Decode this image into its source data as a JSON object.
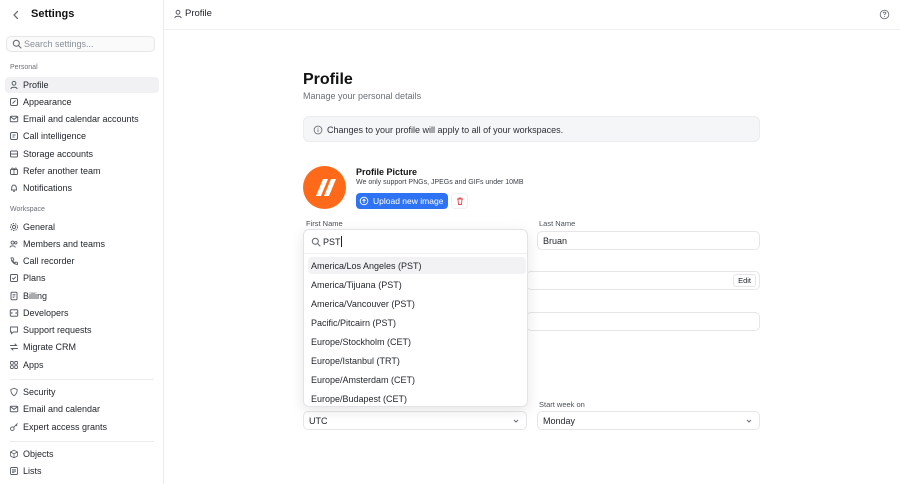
{
  "sidebar": {
    "title": "Settings",
    "search_placeholder": "Search settings...",
    "personal_label": "Personal",
    "personal_items": [
      {
        "label": "Profile",
        "icon": "user-icon"
      },
      {
        "label": "Appearance",
        "icon": "appearance-icon"
      },
      {
        "label": "Email and calendar accounts",
        "icon": "mail-icon"
      },
      {
        "label": "Call intelligence",
        "icon": "call-intelligence-icon"
      },
      {
        "label": "Storage accounts",
        "icon": "storage-icon"
      },
      {
        "label": "Refer another team",
        "icon": "refer-icon"
      },
      {
        "label": "Notifications",
        "icon": "bell-icon"
      }
    ],
    "workspace_label": "Workspace",
    "workspace_items": [
      {
        "label": "General",
        "icon": "gear-icon"
      },
      {
        "label": "Members and teams",
        "icon": "members-icon"
      },
      {
        "label": "Call recorder",
        "icon": "recorder-icon"
      },
      {
        "label": "Plans",
        "icon": "plans-icon"
      },
      {
        "label": "Billing",
        "icon": "billing-icon"
      },
      {
        "label": "Developers",
        "icon": "code-icon"
      },
      {
        "label": "Support requests",
        "icon": "support-icon"
      },
      {
        "label": "Migrate CRM",
        "icon": "migrate-icon"
      },
      {
        "label": "Apps",
        "icon": "apps-icon"
      }
    ],
    "security_items": [
      {
        "label": "Security",
        "icon": "shield-icon"
      },
      {
        "label": "Email and calendar",
        "icon": "mail-icon"
      },
      {
        "label": "Expert access grants",
        "icon": "key-icon"
      }
    ],
    "data_items": [
      {
        "label": "Objects",
        "icon": "objects-icon"
      },
      {
        "label": "Lists",
        "icon": "lists-icon"
      }
    ]
  },
  "header": {
    "title": "Profile"
  },
  "main": {
    "title": "Profile",
    "subtitle": "Manage your personal details",
    "notice": "Changes to your profile will apply to all of your workspaces.",
    "picture": {
      "title": "Profile Picture",
      "subtitle": "We only support PNGs, JPEGs and GIFs under 10MB",
      "upload_label": "Upload new image"
    },
    "first_name_label": "First Name",
    "last_name_label": "Last Name",
    "last_name_value": "Bruan",
    "edit_label": "Edit",
    "timezone_value": "UTC",
    "start_week_label": "Start week on",
    "start_week_value": "Monday"
  },
  "dropdown": {
    "query": "PST",
    "options": [
      "America/Los Angeles (PST)",
      "America/Tijuana (PST)",
      "America/Vancouver (PST)",
      "Pacific/Pitcairn (PST)",
      "Europe/Stockholm (CET)",
      "Europe/Istanbul (TRT)",
      "Europe/Amsterdam (CET)",
      "Europe/Budapest (CET)"
    ]
  },
  "colors": {
    "accent": "#2f73f5",
    "avatar": "#ff6a1a",
    "danger": "#e5484d"
  }
}
